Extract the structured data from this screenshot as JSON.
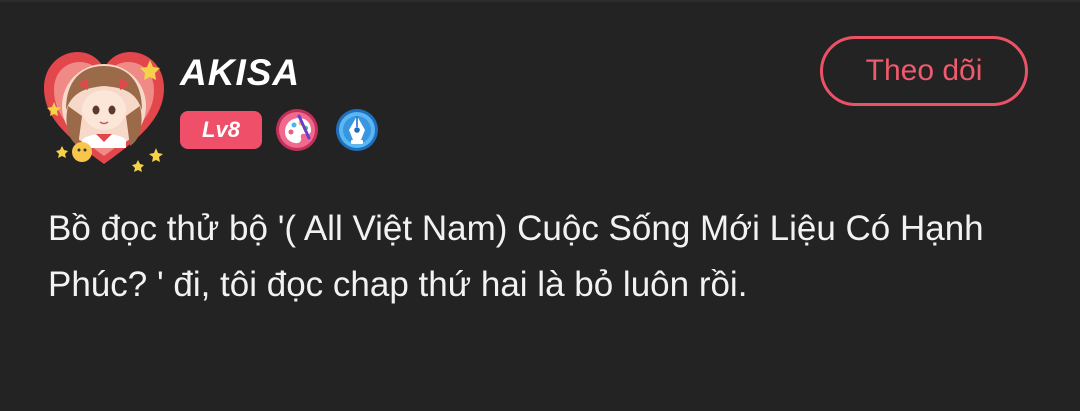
{
  "comment": {
    "user": {
      "name": "AKISA",
      "level": "Lv8",
      "avatar_icon": "anime-girl-avatar-icon",
      "badges": [
        "artist-palette-badge-icon",
        "writer-pen-badge-icon"
      ]
    },
    "follow_label": "Theo dõi",
    "text": "Bồ đọc thử bộ '( All Việt Nam) Cuộc Sống Mới Liệu Có Hạnh Phúc? ' đi, tôi đọc chap thứ hai là bỏ luôn rồi."
  },
  "colors": {
    "background": "#232323",
    "accent": "#ef4f69",
    "text": "#f2f2f2"
  }
}
